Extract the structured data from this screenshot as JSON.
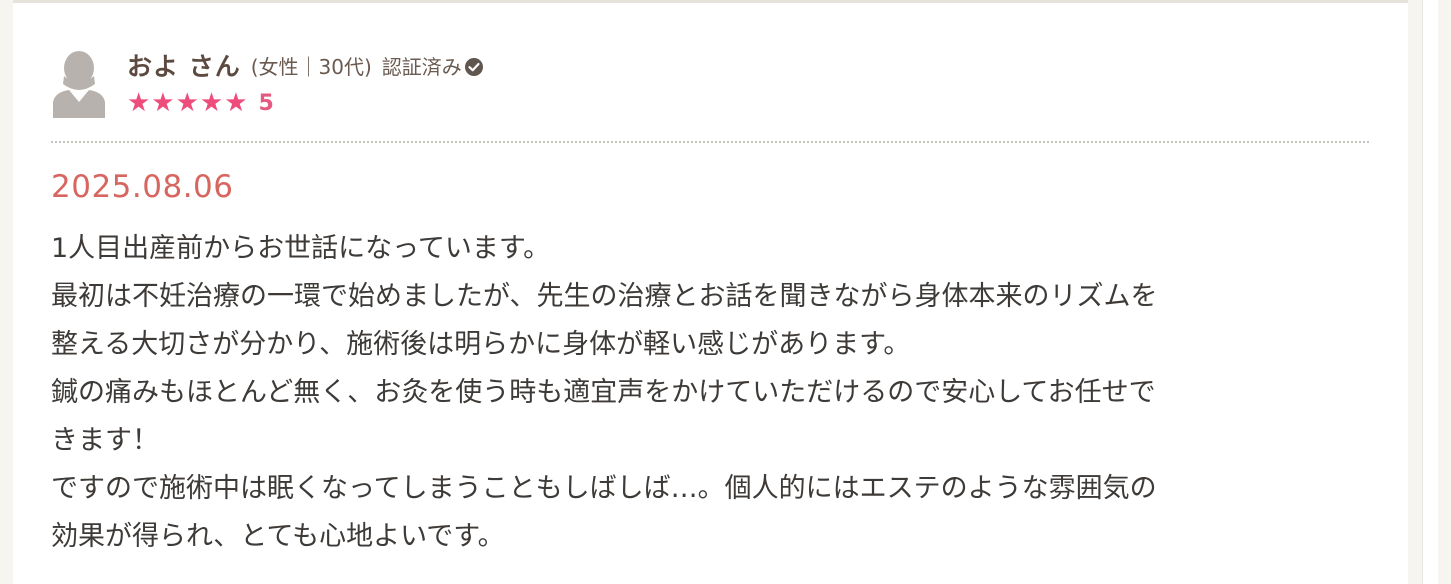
{
  "user": {
    "name": "およ さん",
    "attributes": "(女性｜30代)",
    "verified_label": "認証済み",
    "avatar_icon": "person-silhouette-icon",
    "verified_icon": "check-circle-icon"
  },
  "rating": {
    "stars": "★★★★★",
    "score": "5",
    "star_color": "#ee4d7c"
  },
  "review": {
    "date": "2025.08.06",
    "lines": [
      "1人目出産前からお世話になっています。",
      "最初は不妊治療の一環で始めましたが、先生の治療とお話を聞きながら身体本来のリズムを",
      "整える大切さが分かり、施術後は明らかに身体が軽い感じがあります。",
      "鍼の痛みもほとんど無く、お灸を使う時も適宜声をかけていただけるので安心してお任せで",
      "きます！",
      "ですので施術中は眠くなってしまうこともしばしば…。個人的にはエステのような雰囲気の",
      "効果が得られ、とても心地よいです。"
    ]
  },
  "colors": {
    "date": "#d76660",
    "name": "#5c4a40",
    "body_text": "#3d3a37"
  }
}
